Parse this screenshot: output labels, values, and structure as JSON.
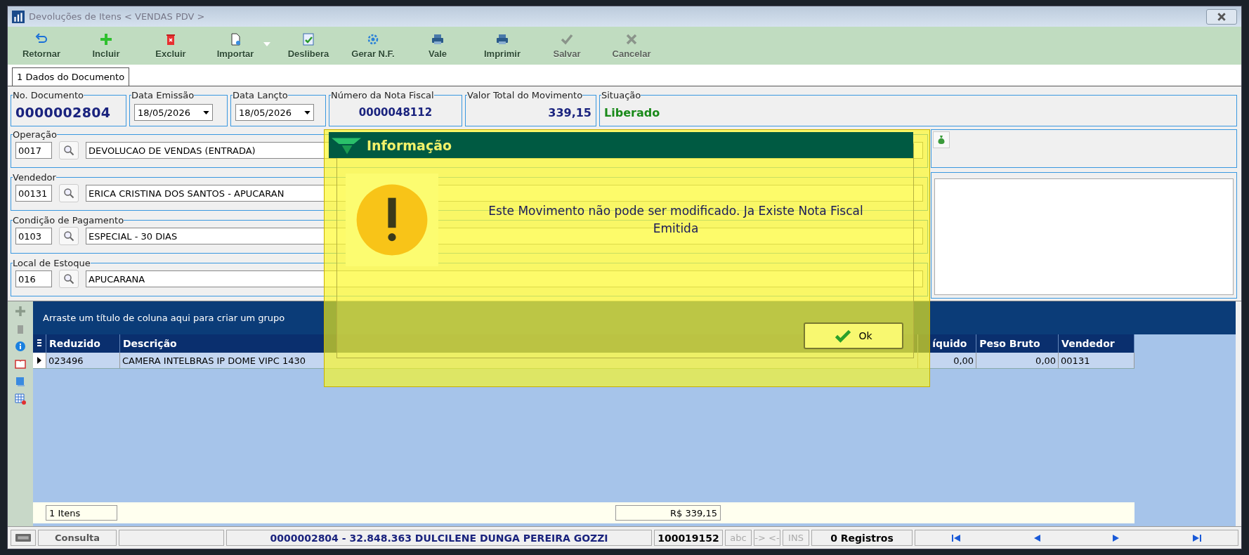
{
  "window": {
    "title": "Devoluções de Itens < VENDAS PDV >"
  },
  "toolbar": [
    {
      "label": "Retornar",
      "kind": "undo",
      "disabled": false
    },
    {
      "label": "Incluir",
      "kind": "plus",
      "disabled": false
    },
    {
      "label": "Excluir",
      "kind": "trash",
      "disabled": false
    },
    {
      "label": "Importar",
      "kind": "import",
      "disabled": false
    },
    {
      "label": "Deslibera",
      "kind": "doccheck",
      "disabled": false
    },
    {
      "label": "Gerar N.F.",
      "kind": "gear",
      "disabled": false
    },
    {
      "label": "Vale",
      "kind": "printer",
      "disabled": false
    },
    {
      "label": "Imprimir",
      "kind": "printer",
      "disabled": false
    },
    {
      "label": "Salvar",
      "kind": "check",
      "disabled": true
    },
    {
      "label": "Cancelar",
      "kind": "cross",
      "disabled": true
    }
  ],
  "tabs": [
    {
      "label": "1 Dados do Documento",
      "selected": true
    }
  ],
  "header_fields": [
    {
      "label": "No. Documento",
      "value": "0000002804",
      "kind": "number"
    },
    {
      "label": "Data Emissão",
      "value": "18/05/2026",
      "kind": "date"
    },
    {
      "label": "Data Lançto",
      "value": "18/05/2026",
      "kind": "date"
    },
    {
      "label": "Número da Nota Fiscal",
      "value": "0000048112",
      "kind": "invoice"
    },
    {
      "label": "Valor Total do Movimento",
      "value": "339,15",
      "kind": "amount"
    },
    {
      "label": "Situação",
      "value": "Liberado",
      "kind": "status"
    }
  ],
  "lookups": [
    {
      "label": "Operação",
      "code": "0017",
      "description": "DEVOLUCAO DE VENDAS (ENTRADA)"
    },
    {
      "label": "Vendedor",
      "code": "00131",
      "description": "ERICA CRISTINA DOS SANTOS - APUCARAN"
    },
    {
      "label": "Condição de Pagamento",
      "code": "0103",
      "description": "ESPECIAL - 30 DIAS"
    },
    {
      "label": "Local de Estoque",
      "code": "016",
      "description": "APUCARANA"
    }
  ],
  "grid": {
    "group_hint": "Arraste um título de coluna aqui para criar um grupo",
    "columns": [
      "Reduzido",
      "Descrição",
      "íquido",
      "Peso Bruto",
      "Vendedor"
    ],
    "rows": [
      {
        "selected": true,
        "cells": [
          "023496",
          "CAMERA INTELBRAS IP DOME VIPC 1430",
          "0,00",
          "0,00",
          "00131"
        ]
      }
    ],
    "footer": {
      "count": "1 Itens",
      "total": "R$ 339,15"
    }
  },
  "status_bar": {
    "mode": "Consulta",
    "record": "0000002804 - 32.848.363 DULCILENE DUNGA PEREIRA GOZZI",
    "code": "100019152",
    "indicators": [
      {
        "label": "abc",
        "disabled": true
      },
      {
        "label": "-> <-",
        "disabled": true
      },
      {
        "label": "INS",
        "disabled": true
      }
    ],
    "registros": "0 Registros"
  },
  "dialog": {
    "title": "Informação",
    "message": "Este Movimento não pode ser modificado. Ja Existe Nota Fiscal Emitida",
    "button": "Ok"
  }
}
